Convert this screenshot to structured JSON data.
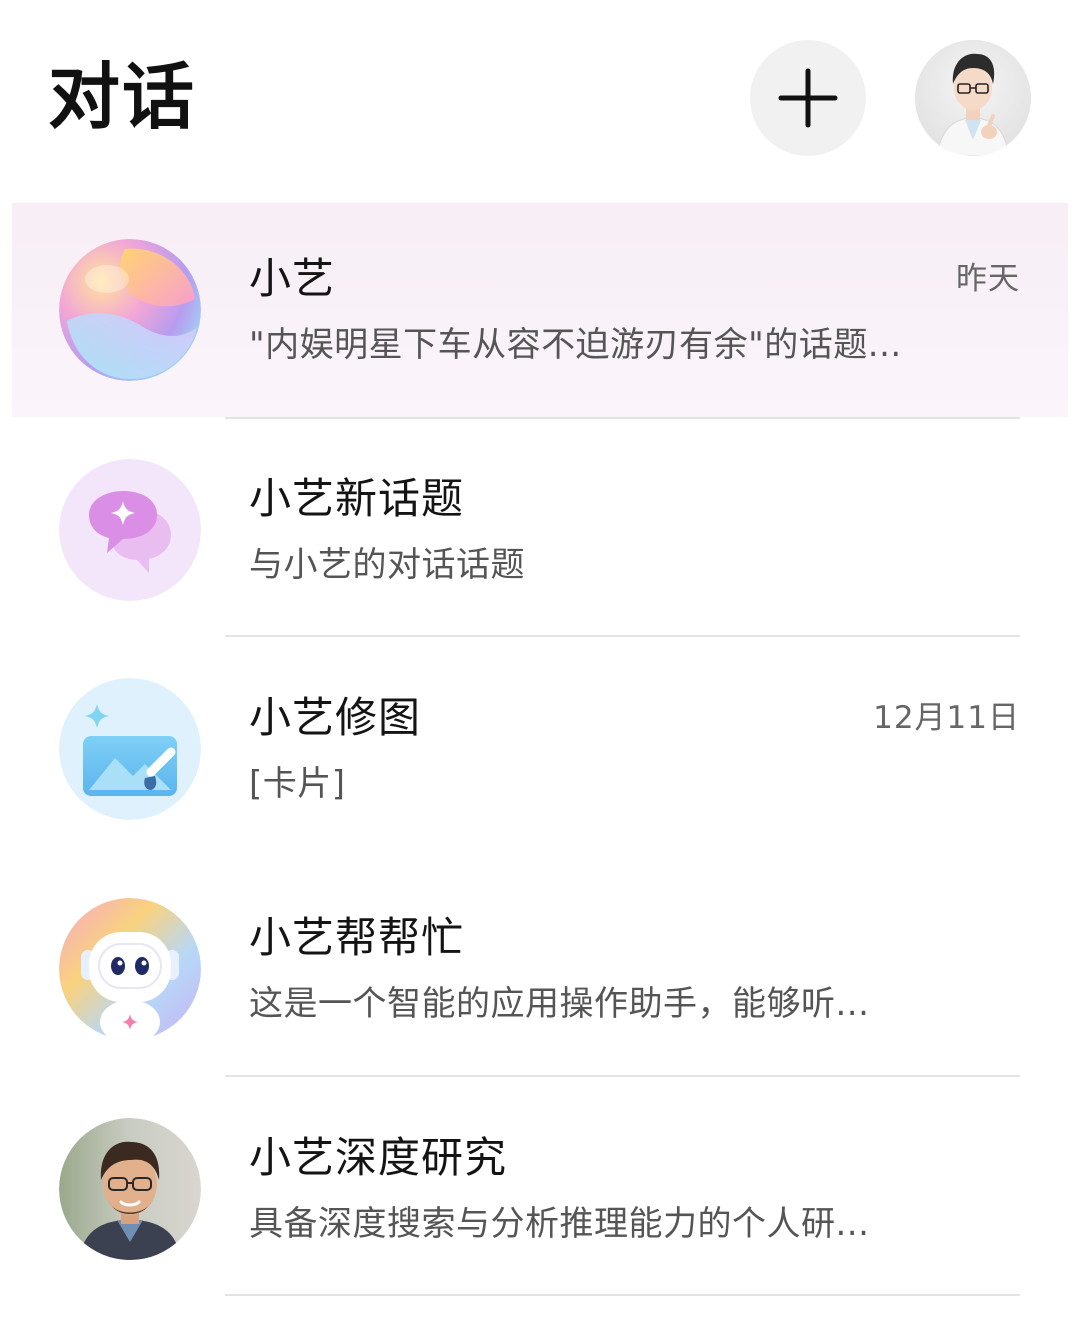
{
  "header": {
    "title": "对话",
    "new_chat_icon": "plus-icon",
    "avatar_icon": "user-avatar-cartoon"
  },
  "conversations": [
    {
      "name": "小艺",
      "preview": "\"内娱明星下车从容不迫游刃有余\"的话题...",
      "time": "昨天",
      "avatar_icon": "xiaoyi-orb-icon",
      "highlighted": true
    },
    {
      "name": "小艺新话题",
      "preview": "与小艺的对话话题",
      "time": "",
      "avatar_icon": "chat-bubbles-sparkle-icon",
      "highlighted": false
    },
    {
      "name": "小艺修图",
      "preview": "[卡片]",
      "time": "12月11日",
      "avatar_icon": "image-brush-icon",
      "highlighted": false
    },
    {
      "name": "小艺帮帮忙",
      "preview": "这是一个智能的应用操作助手，能够听...",
      "time": "",
      "avatar_icon": "robot-mascot-icon",
      "highlighted": false
    },
    {
      "name": "小艺深度研究",
      "preview": "具备深度搜索与分析推理能力的个人研...",
      "time": "",
      "avatar_icon": "researcher-portrait-icon",
      "highlighted": false
    }
  ],
  "colors": {
    "highlight_bg": "#f8eef6",
    "divider": "#e4e4e4",
    "preview_text": "#555555",
    "button_bg": "#f1f1f1"
  }
}
